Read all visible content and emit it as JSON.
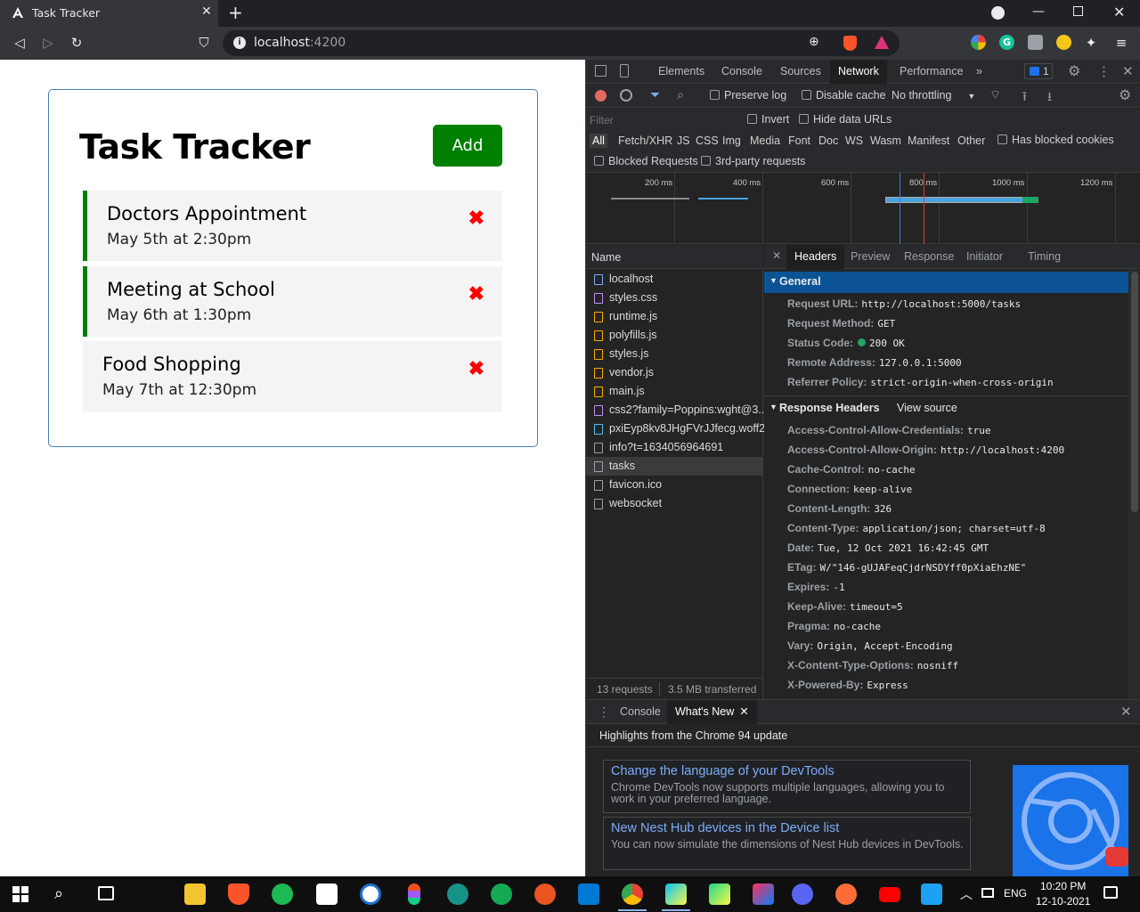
{
  "browser": {
    "tab_title": "Task Tracker",
    "url_host": "localhost",
    "url_port": ":4200"
  },
  "app": {
    "title": "Task Tracker",
    "add_label": "Add",
    "delete_glyph": "✖",
    "tasks": [
      {
        "text": "Doctors Appointment",
        "day": "May 5th at 2:30pm",
        "reminder": true
      },
      {
        "text": "Meeting at School",
        "day": "May 6th at 1:30pm",
        "reminder": true
      },
      {
        "text": "Food Shopping",
        "day": "May 7th at 12:30pm",
        "reminder": false
      }
    ]
  },
  "devtools": {
    "tabs": [
      "Elements",
      "Console",
      "Sources",
      "Network",
      "Performance"
    ],
    "active_tab": "Network",
    "issues_count": "1",
    "toolbar": {
      "preserve_log": "Preserve log",
      "disable_cache": "Disable cache",
      "throttling": "No throttling"
    },
    "filter": {
      "placeholder": "Filter",
      "invert": "Invert",
      "hide_data_urls": "Hide data URLs",
      "types": [
        "All",
        "Fetch/XHR",
        "JS",
        "CSS",
        "Img",
        "Media",
        "Font",
        "Doc",
        "WS",
        "Wasm",
        "Manifest",
        "Other"
      ],
      "has_blocked_cookies": "Has blocked cookies",
      "blocked_requests": "Blocked Requests",
      "third_party": "3rd-party requests"
    },
    "timeline_ticks": [
      "200 ms",
      "400 ms",
      "600 ms",
      "800 ms",
      "1000 ms",
      "1200 ms"
    ],
    "name_header": "Name",
    "requests": [
      {
        "name": "localhost",
        "type": "doc"
      },
      {
        "name": "styles.css",
        "type": "css"
      },
      {
        "name": "runtime.js",
        "type": "js"
      },
      {
        "name": "polyfills.js",
        "type": "js"
      },
      {
        "name": "styles.js",
        "type": "js"
      },
      {
        "name": "vendor.js",
        "type": "js"
      },
      {
        "name": "main.js",
        "type": "js"
      },
      {
        "name": "css2?family=Poppins:wght@3...",
        "type": "css"
      },
      {
        "name": "pxiEyp8kv8JHgFVrJJfecg.woff2",
        "type": "font"
      },
      {
        "name": "info?t=1634056964691",
        "type": "other"
      },
      {
        "name": "tasks",
        "type": "other",
        "selected": true
      },
      {
        "name": "favicon.ico",
        "type": "other"
      },
      {
        "name": "websocket",
        "type": "other"
      }
    ],
    "summary_requests": "13 requests",
    "summary_transferred": "3.5 MB transferred",
    "detail_tabs": [
      "Headers",
      "Preview",
      "Response",
      "Initiator",
      "Timing"
    ],
    "general_title": "General",
    "general": [
      {
        "k": "Request URL:",
        "v": "http://localhost:5000/tasks"
      },
      {
        "k": "Request Method:",
        "v": "GET"
      },
      {
        "k": "Status Code:",
        "v": "200 OK"
      },
      {
        "k": "Remote Address:",
        "v": "127.0.0.1:5000"
      },
      {
        "k": "Referrer Policy:",
        "v": "strict-origin-when-cross-origin"
      }
    ],
    "response_headers_title": "Response Headers",
    "view_source": "View source",
    "response_headers": [
      {
        "k": "Access-Control-Allow-Credentials:",
        "v": "true"
      },
      {
        "k": "Access-Control-Allow-Origin:",
        "v": "http://localhost:4200"
      },
      {
        "k": "Cache-Control:",
        "v": "no-cache"
      },
      {
        "k": "Connection:",
        "v": "keep-alive"
      },
      {
        "k": "Content-Length:",
        "v": "326"
      },
      {
        "k": "Content-Type:",
        "v": "application/json; charset=utf-8"
      },
      {
        "k": "Date:",
        "v": "Tue, 12 Oct 2021 16:42:45 GMT"
      },
      {
        "k": "ETag:",
        "v": "W/\"146-gUJAFeqCjdrNSDYff0pXiaEhzNE\""
      },
      {
        "k": "Expires:",
        "v": "-1"
      },
      {
        "k": "Keep-Alive:",
        "v": "timeout=5"
      },
      {
        "k": "Pragma:",
        "v": "no-cache"
      },
      {
        "k": "Vary:",
        "v": "Origin, Accept-Encoding"
      },
      {
        "k": "X-Content-Type-Options:",
        "v": "nosniff"
      },
      {
        "k": "X-Powered-By:",
        "v": "Express"
      }
    ],
    "drawer": {
      "console_tab": "Console",
      "whats_new_tab": "What's New",
      "highlights": "Highlights from the Chrome 94 update",
      "news": [
        {
          "title": "Change the language of your DevTools",
          "body": "Chrome DevTools now supports multiple languages, allowing you to work in your preferred language."
        },
        {
          "title": "New Nest Hub devices in the Device list",
          "body": "You can now simulate the dimensions of Nest Hub devices in DevTools."
        }
      ]
    }
  },
  "taskbar": {
    "language": "ENG",
    "time": "10:20 PM",
    "date": "12-10-2021"
  },
  "colors": {
    "accent_green": "#008000",
    "delete_red": "#ff0000",
    "devtools_bg": "#242424",
    "selected_section": "#0b5394"
  }
}
